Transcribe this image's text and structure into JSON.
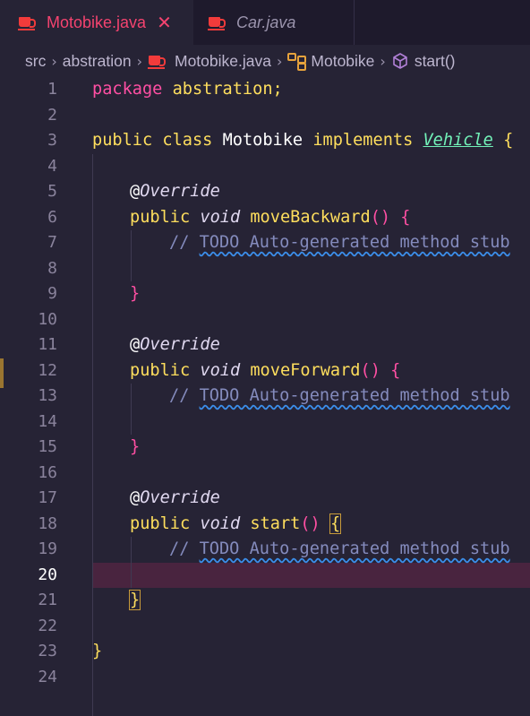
{
  "tabs": [
    {
      "label": "Motobike.java",
      "icon": "java-icon",
      "active": true
    },
    {
      "label": "Car.java",
      "icon": "java-icon",
      "active": false
    }
  ],
  "breadcrumb": {
    "items": [
      "src",
      "abstration",
      "Motobike.java",
      "Motobike",
      "start()"
    ],
    "icons": [
      "",
      "",
      "java-icon",
      "class-icon",
      "method-icon"
    ]
  },
  "editor": {
    "current_line": 20,
    "line_numbers": [
      "1",
      "2",
      "3",
      "4",
      "5",
      "6",
      "7",
      "8",
      "9",
      "10",
      "11",
      "12",
      "13",
      "14",
      "15",
      "16",
      "17",
      "18",
      "19",
      "20",
      "21",
      "22",
      "23",
      "24"
    ],
    "code": {
      "l1_kw": "package",
      "l1_rest": " abstration;",
      "l3_public": "public",
      "l3_class": "class",
      "l3_name": "Motobike",
      "l3_impl": "implements",
      "l3_iface": "Vehicle",
      "l3_brace": "{",
      "override": "@",
      "override_name": "Override",
      "public": "public",
      "void": "void",
      "m1_name": "moveBackward",
      "m2_name": "moveForward",
      "m3_name": "start",
      "parens": "()",
      "open_brace": "{",
      "close_brace": "}",
      "comment_prefix": "// ",
      "comment_body": "TODO Auto-generated method stub"
    }
  },
  "colors": {
    "background": "#262335",
    "keyword": "#ff4fa3",
    "identifier": "#fede5d",
    "interface": "#72f1b8",
    "comment": "#848bbd",
    "current_line": "#49243f"
  }
}
